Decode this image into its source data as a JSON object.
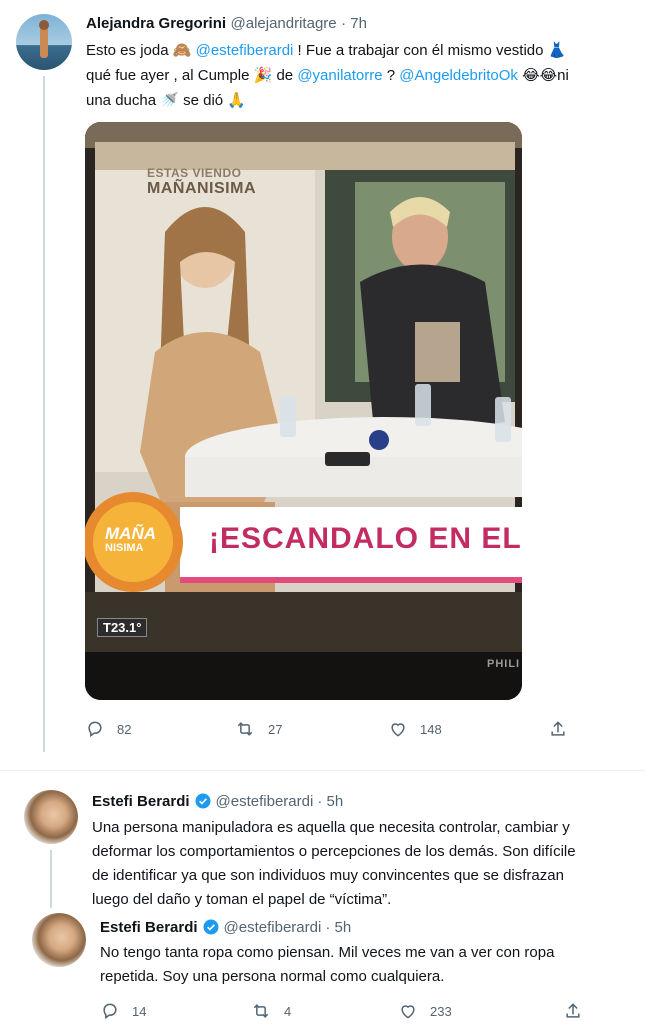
{
  "tweet1": {
    "name": "Alejandra Gregorini",
    "handle": "@alejandritagre",
    "time": "· 7h",
    "line1_a": "Esto es joda",
    "line1_b": "@estefiberardi",
    "line1_c": "! Fue a trabajar con él mismo vestido",
    "line2_a": "qué fue ayer , al Cumple",
    "line2_b": "de",
    "line2_c": "@yanilatorre",
    "line2_d": "?",
    "line2_e": "@AngeldebritoOk",
    "line2_f": "ni",
    "line3_a": "una ducha",
    "line3_b": "se dió",
    "image": {
      "estas_viendo": "ESTAS VIENDO",
      "program": "MAÑANISIMA",
      "banner": "¡ESCANDALO EN EL C",
      "logo_top": "MAÑA",
      "logo_bottom": "NISIMA",
      "temp": "T23.1°",
      "brand": "PHILI"
    },
    "replies": "82",
    "retweets": "27",
    "likes": "148"
  },
  "tweet2": {
    "name": "Estefi Berardi",
    "handle": "@estefiberardi",
    "time": "· 5h",
    "line1": "Una persona manipuladora es aquella que necesita controlar, cambiar y",
    "line2": "deformar los comportamientos o percepciones de los demás. Son difícile",
    "line3": "de identificar ya que son individuos muy convincentes que se disfrazan",
    "line4": "luego del daño y toman el papel de “víctima”."
  },
  "tweet3": {
    "name": "Estefi Berardi",
    "handle": "@estefiberardi",
    "time": "· 5h",
    "line1": "No tengo tanta ropa como piensan. Mil veces me van a ver con ropa",
    "line2": "repetida. Soy una persona normal como cualquiera.",
    "replies": "14",
    "retweets": "4",
    "likes": "233"
  },
  "colors": {
    "link": "#1d9bf0",
    "verified": "#1d9bf0",
    "secondary": "#536471"
  }
}
